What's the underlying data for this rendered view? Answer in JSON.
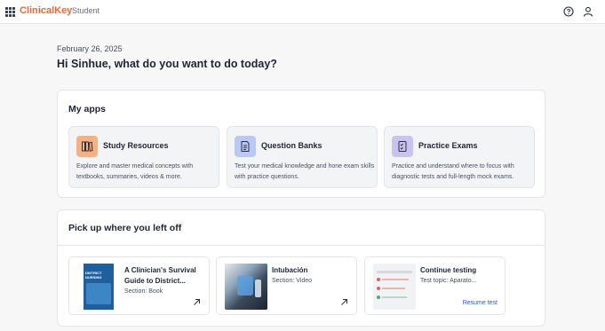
{
  "header": {
    "brand": "ClinicalKey",
    "brand_sub": "Student",
    "brand_color": "#e86a3a"
  },
  "main": {
    "date": "February 26, 2025",
    "greeting": "Hi Sinhue, what do you want to do today?"
  },
  "apps": {
    "title": "My apps",
    "items": [
      {
        "title": "Study Resources",
        "description": "Explore and master medical concepts with textbooks, summaries, videos & more.",
        "icon": "books-icon",
        "icon_bg": "#f6b183"
      },
      {
        "title": "Question Banks",
        "description": "Test your medical knowledge and hone exam skills with practice questions.",
        "icon": "document-icon",
        "icon_bg": "#b9c8f4"
      },
      {
        "title": "Practice Exams",
        "description": "Practice and understand where to focus with diagnostic tests and full-length mock exams.",
        "icon": "exam-icon",
        "icon_bg": "#c9c3f0"
      }
    ]
  },
  "resume": {
    "title": "Pick up where you left off",
    "items": [
      {
        "title": "A Clinician's Survival Guide to District...",
        "section": "Section: Book",
        "thumb_text": "DISTRICT NURSING"
      },
      {
        "title": "Intubación",
        "section": "Section: Video"
      },
      {
        "title": "Continue testing",
        "section": "Test topic: Aparato...",
        "link": "Resume test"
      }
    ]
  }
}
